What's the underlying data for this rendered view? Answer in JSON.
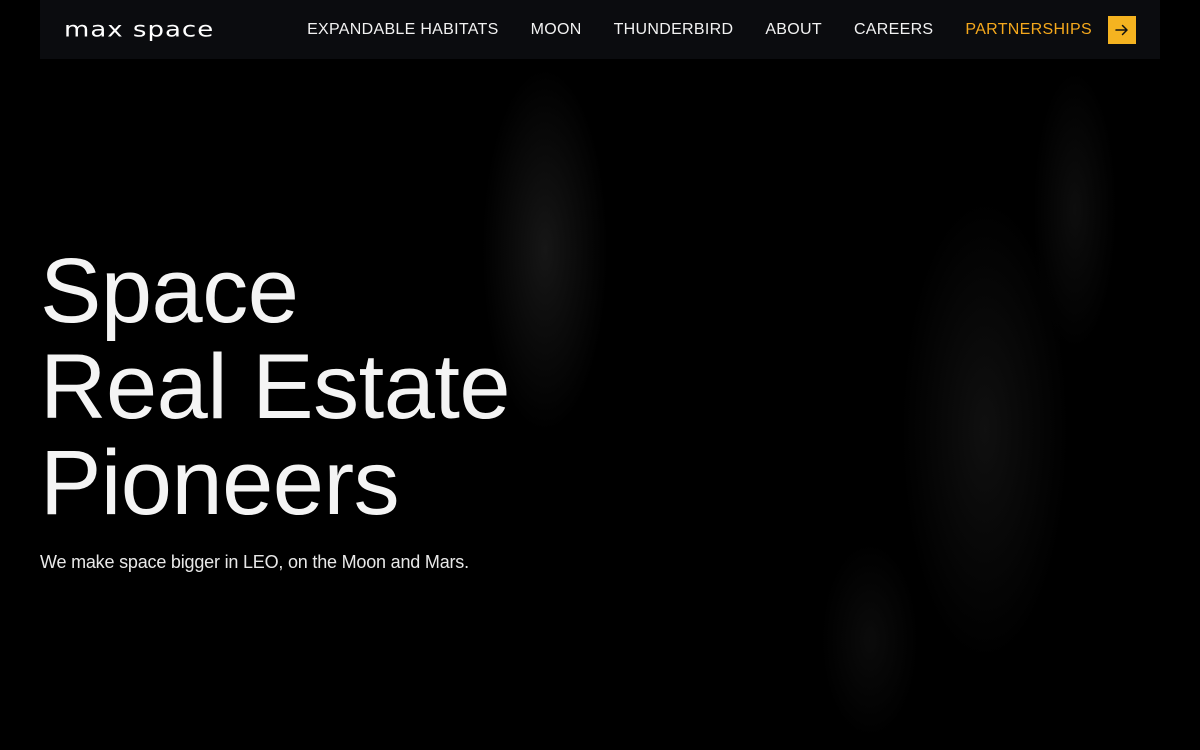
{
  "brand": {
    "logo_text": "max space"
  },
  "nav": {
    "items": [
      {
        "label": "EXPANDABLE HABITATS"
      },
      {
        "label": "MOON"
      },
      {
        "label": "THUNDERBIRD"
      },
      {
        "label": "ABOUT"
      },
      {
        "label": "CAREERS"
      },
      {
        "label": "PARTNERSHIPS"
      }
    ],
    "cta_icon": "arrow-right-icon"
  },
  "hero": {
    "title_lines": [
      "Space",
      "Real Estate",
      "Pioneers"
    ],
    "subtitle": "We make space bigger in LEO, on the Moon and Mars."
  },
  "colors": {
    "background": "#000000",
    "navbar": "#0b0c0f",
    "accent": "#f5a81c",
    "text": "#ffffff"
  }
}
